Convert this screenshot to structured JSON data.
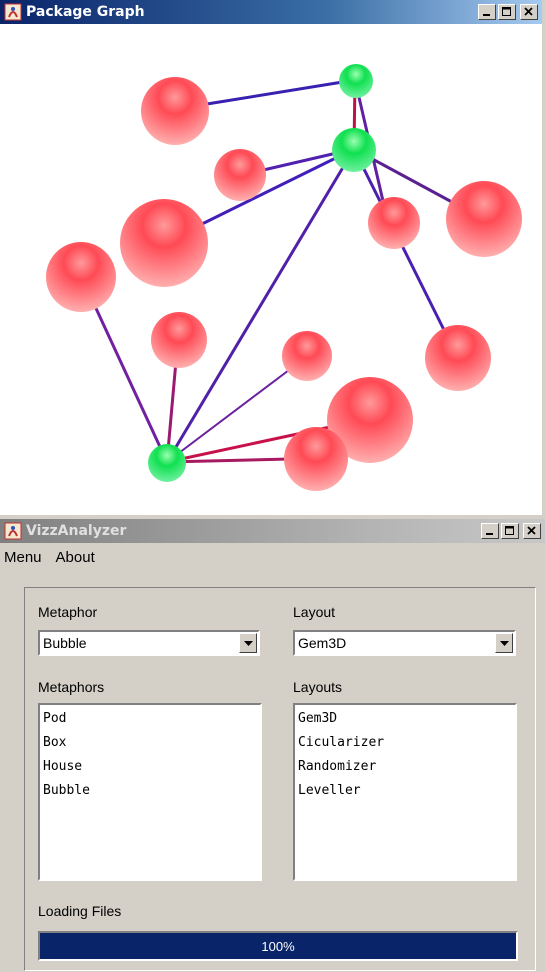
{
  "graph_window": {
    "title": "Package Graph",
    "controls": {
      "minimize": "_",
      "maximize": "□",
      "close": "×"
    }
  },
  "analyzer_window": {
    "title": "VizzAnalyzer",
    "menu": [
      "Menu",
      "About"
    ],
    "metaphor": {
      "label": "Metaphor",
      "selected": "Bubble"
    },
    "layout": {
      "label": "Layout",
      "selected": "Gem3D"
    },
    "metaphors": {
      "label": "Metaphors",
      "items": [
        "Pod",
        "Box",
        "House",
        "Bubble"
      ]
    },
    "layouts": {
      "label": "Layouts",
      "items": [
        "Gem3D",
        "Cicularizer",
        "Randomizer",
        "Leveller"
      ]
    },
    "loading": {
      "label": "Loading Files",
      "progress_text": "100%",
      "progress": 1.0
    }
  },
  "colors": {
    "node_red": "#f06060",
    "node_green": "#20e060",
    "edge_blue": "#2020c0",
    "edge_red": "#d01040",
    "title_active": "#0a246a",
    "progress_fill": "#0a246a"
  }
}
